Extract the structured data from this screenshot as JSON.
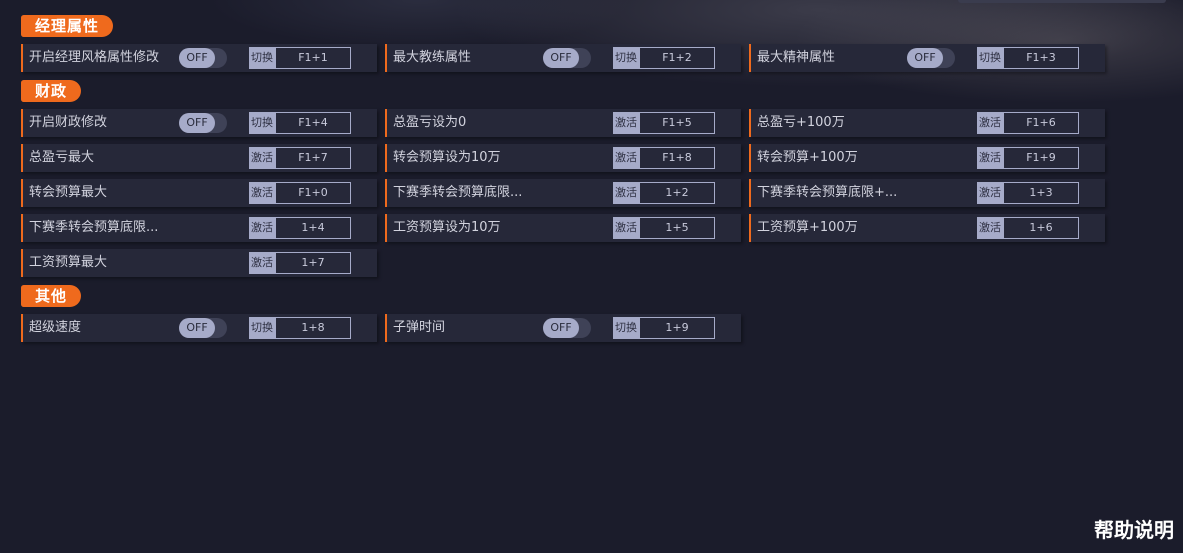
{
  "sections": {
    "attrs": {
      "title": "经理属性",
      "rows": [
        {
          "label": "开启经理风格属性修改",
          "toggle": "OFF",
          "key_type": "切换",
          "hotkey": "F1+1"
        },
        {
          "label": "最大教练属性",
          "toggle": "OFF",
          "key_type": "切换",
          "hotkey": "F1+2"
        },
        {
          "label": "最大精神属性",
          "toggle": "OFF",
          "key_type": "切换",
          "hotkey": "F1+3"
        }
      ]
    },
    "finance": {
      "title": "财政",
      "rows": [
        {
          "label": "开启财政修改",
          "toggle": "OFF",
          "key_type": "切换",
          "hotkey": "F1+4"
        },
        {
          "label": "总盈亏设为0",
          "key_type": "激活",
          "hotkey": "F1+5"
        },
        {
          "label": "总盈亏+100万",
          "key_type": "激活",
          "hotkey": "F1+6"
        },
        {
          "label": "总盈亏最大",
          "key_type": "激活",
          "hotkey": "F1+7"
        },
        {
          "label": "转会预算设为10万",
          "key_type": "激活",
          "hotkey": "F1+8"
        },
        {
          "label": "转会预算+100万",
          "key_type": "激活",
          "hotkey": "F1+9"
        },
        {
          "label": "转会预算最大",
          "key_type": "激活",
          "hotkey": "F1+0"
        },
        {
          "label": "下赛季转会预算底限...",
          "key_type": "激活",
          "hotkey": "1+2"
        },
        {
          "label": "下赛季转会预算底限+...",
          "key_type": "激活",
          "hotkey": "1+3"
        },
        {
          "label": "下赛季转会预算底限...",
          "key_type": "激活",
          "hotkey": "1+4"
        },
        {
          "label": "工资预算设为10万",
          "key_type": "激活",
          "hotkey": "1+5"
        },
        {
          "label": "工资预算+100万",
          "key_type": "激活",
          "hotkey": "1+6"
        },
        {
          "label": "工资预算最大",
          "key_type": "激活",
          "hotkey": "1+7"
        }
      ]
    },
    "other": {
      "title": "其他",
      "rows": [
        {
          "label": "超级速度",
          "toggle": "OFF",
          "key_type": "切换",
          "hotkey": "1+8"
        },
        {
          "label": "子弹时间",
          "toggle": "OFF",
          "key_type": "切换",
          "hotkey": "1+9"
        }
      ]
    }
  },
  "help_link": "帮助说明",
  "colors": {
    "accent": "#ef6a1d",
    "row_bg": "#262839",
    "key_fill": "#a6abc9",
    "page_bg": "#1b1c2b"
  }
}
